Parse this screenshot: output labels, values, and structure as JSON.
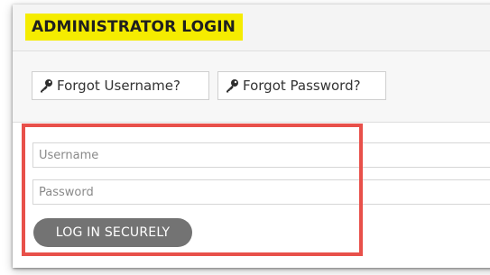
{
  "header": {
    "title": "ADMINISTRATOR LOGIN",
    "title_highlight_color": "#f5ec00"
  },
  "links": {
    "forgot_username": {
      "label": "Forgot Username?",
      "icon": "key-icon"
    },
    "forgot_password": {
      "label": "Forgot Password?",
      "icon": "key-icon"
    }
  },
  "form": {
    "username_placeholder": "Username",
    "username_value": "",
    "password_placeholder": "Password",
    "password_value": "",
    "submit_label": "LOG IN SECURELY",
    "submit_color": "#737373"
  },
  "annotation": {
    "highlight_color": "#e8504a"
  }
}
